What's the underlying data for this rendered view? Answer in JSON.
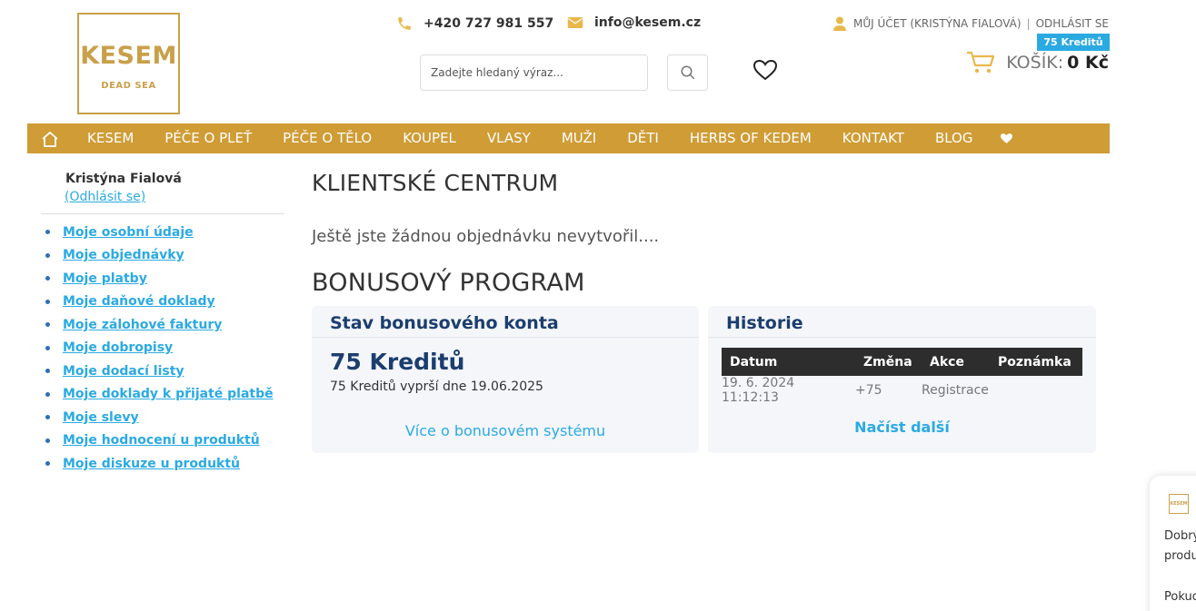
{
  "header": {
    "logo": {
      "brand": "KESEM",
      "sub": "DEAD SEA"
    },
    "phone": "+420 727 981 557",
    "email": "info@kesem.cz",
    "search": {
      "placeholder": "Zadejte hledaný výraz..."
    },
    "account": {
      "label": "MŮJ ÚČET (KRISTÝNA FIALOVÁ)",
      "logout": "ODHLÁSIT SE"
    },
    "credits_badge": "75 Kreditů",
    "cart": {
      "label": "KOŠÍK:",
      "price": "0 Kč"
    }
  },
  "nav": {
    "items": [
      "KESEM",
      "PÉČE O PLEŤ",
      "PÉČE O TĚLO",
      "KOUPEL",
      "VLASY",
      "MUŽI",
      "DĚTI",
      "HERBS OF KEDEM",
      "KONTAKT",
      "BLOG"
    ]
  },
  "sidebar": {
    "user_name": "Kristýna Fialová",
    "logout": "(Odhlásit se)",
    "links": [
      "Moje osobní údaje",
      "Moje objednávky",
      "Moje platby",
      "Moje daňové doklady",
      "Moje zálohové faktury",
      "Moje dobropisy",
      "Moje dodací listy",
      "Moje doklady k přijaté platbě",
      "Moje slevy",
      "Moje hodnocení u produktů",
      "Moje diskuze u produktů"
    ]
  },
  "main": {
    "title": "KLIENTSKÉ CENTRUM",
    "no_orders": "Ještě jste žádnou objednávku nevytvořil....",
    "bonus_title": "BONUSOVÝ PROGRAM",
    "status": {
      "heading": "Stav bonusového konta",
      "credits": "75 Kreditů",
      "expire": "75 Kreditů vyprší dne 19.06.2025",
      "more": "Více o bonusovém systému"
    },
    "history": {
      "heading": "Historie",
      "columns": [
        "Datum",
        "Změna",
        "Akce",
        "Poznámka"
      ],
      "rows": [
        {
          "date": "19. 6. 2024 11:12:13",
          "change": "+75",
          "action": "Registrace",
          "note": ""
        }
      ],
      "load_more": "Načíst další"
    }
  },
  "chat": {
    "logo": "KESEM",
    "line1": "Dobrý",
    "line2": "produ",
    "line3": "Pokud"
  },
  "colors": {
    "gold": "#cf9c35",
    "blue": "#2baae1",
    "navy": "#1c3e6e"
  }
}
